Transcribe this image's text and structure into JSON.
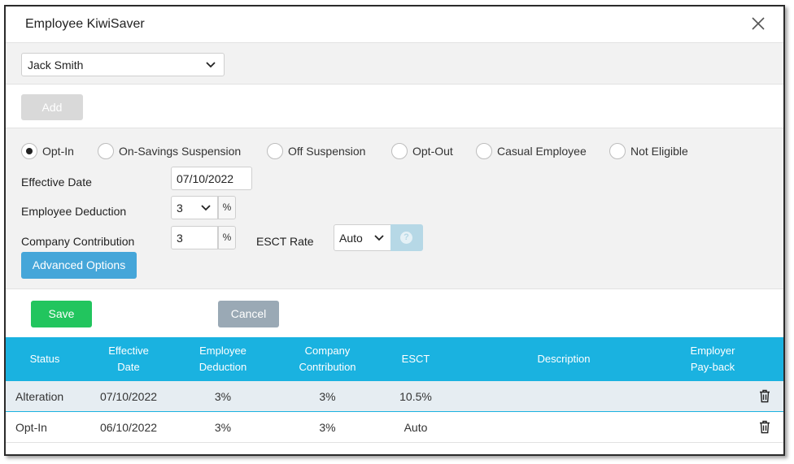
{
  "dialog": {
    "title": "Employee KiwiSaver"
  },
  "employee_select": {
    "value": "Jack Smith"
  },
  "add_label": "Add",
  "status_options": [
    {
      "label": "Opt-In",
      "selected": true
    },
    {
      "label": "On-Savings Suspension",
      "selected": false
    },
    {
      "label": "Off Suspension",
      "selected": false
    },
    {
      "label": "Opt-Out",
      "selected": false
    },
    {
      "label": "Casual Employee",
      "selected": false
    },
    {
      "label": "Not Eligible",
      "selected": false
    }
  ],
  "form": {
    "effective_date_label": "Effective Date",
    "effective_date_value": "07/10/2022",
    "employee_deduction_label": "Employee Deduction",
    "employee_deduction_value": "3",
    "company_contribution_label": "Company Contribution",
    "company_contribution_value": "3",
    "percent": "%",
    "esct_rate_label": "ESCT Rate",
    "esct_rate_value": "Auto",
    "help_icon": "question-circle-icon",
    "advanced_options_label": "Advanced Options"
  },
  "actions": {
    "save_label": "Save",
    "cancel_label": "Cancel"
  },
  "table": {
    "headers": {
      "status": "Status",
      "effective_date_1": "Effective",
      "effective_date_2": "Date",
      "employee_deduction_1": "Employee",
      "employee_deduction_2": "Deduction",
      "company_contribution_1": "Company",
      "company_contribution_2": "Contribution",
      "esct": "ESCT",
      "description": "Description",
      "employer_payback_1": "Employer",
      "employer_payback_2": "Pay-back"
    },
    "rows": [
      {
        "status": "Alteration",
        "effective_date": "07/10/2022",
        "employee_deduction": "3%",
        "company_contribution": "3%",
        "esct": "10.5%",
        "description": "",
        "employer_payback": ""
      },
      {
        "status": "Opt-In",
        "effective_date": "06/10/2022",
        "employee_deduction": "3%",
        "company_contribution": "3%",
        "esct": "Auto",
        "description": "",
        "employer_payback": ""
      }
    ]
  },
  "colors": {
    "header_blue": "#1ab2e0",
    "save_green": "#22c55e",
    "advanced_blue": "#45a6d9",
    "cancel_gray": "#9aa9b5"
  }
}
